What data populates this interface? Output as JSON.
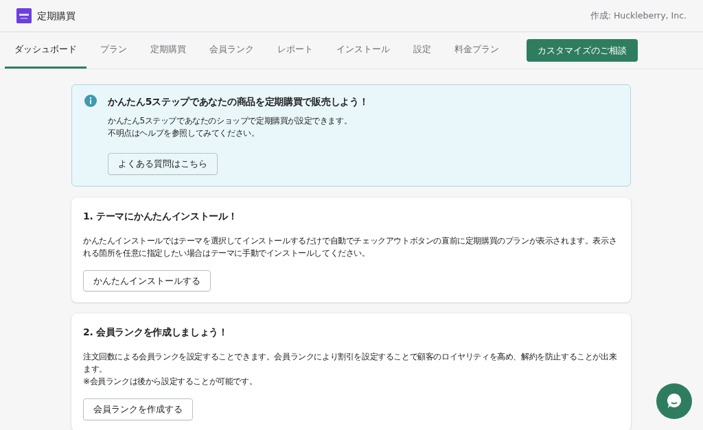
{
  "header": {
    "app_title": "定期購買",
    "author": "作成: Huckleberry, Inc."
  },
  "tabs": [
    {
      "label": "ダッシュボード",
      "selected": true
    },
    {
      "label": "プラン",
      "selected": false
    },
    {
      "label": "定期購買",
      "selected": false
    },
    {
      "label": "会員ランク",
      "selected": false
    },
    {
      "label": "レポート",
      "selected": false
    },
    {
      "label": "インストール",
      "selected": false
    },
    {
      "label": "設定",
      "selected": false
    },
    {
      "label": "料金プラン",
      "selected": false
    }
  ],
  "consult_button": "カスタマイズのご相談",
  "info_banner": {
    "title": "かんたん5ステップであなたの商品を定期購買で販売しよう！",
    "lines": [
      "かんたん5ステップであなたのショップで定期購買が設定できます。",
      "不明点はヘルプを参照してみてください。"
    ],
    "button": "よくある質問はこちら"
  },
  "steps": [
    {
      "title": "1. テーマにかんたんインストール！",
      "lines": [
        "かんたんインストールではテーマを選択してインストールするだけで自動でチェックアウトボタンの直前に定期購買のプランが表示されます。表示される箇所を任意に指定したい場合はテーマに手動でインストールしてください。"
      ],
      "button": "かんたんインストールする"
    },
    {
      "title": "2. 会員ランクを作成しましょう！",
      "lines": [
        "注文回数による会員ランクを設定することできます。会員ランクにより割引を設定することで顧客のロイヤリティを高め、解約を防止することが出来ます。",
        "※会員ランクは後から設定することが可能です。"
      ],
      "button": "会員ランクを作成する"
    }
  ]
}
